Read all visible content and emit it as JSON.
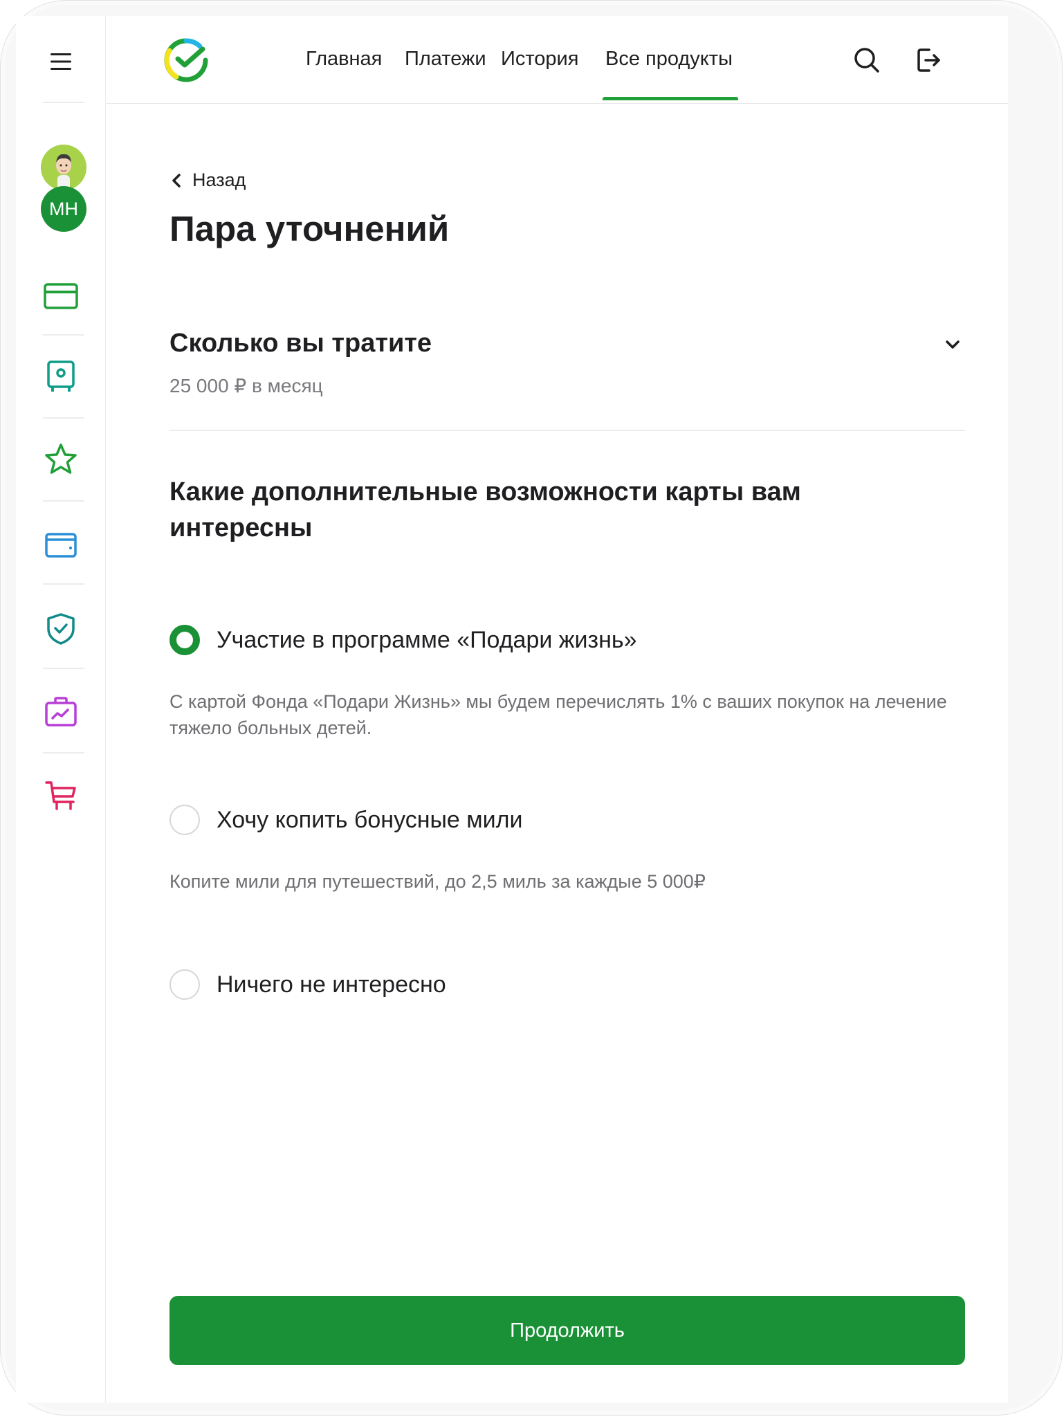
{
  "colors": {
    "brand_green": "#21a038",
    "button_green": "#1a9136",
    "avatar_green": "#1a9136",
    "text_primary": "#1f1f22",
    "text_secondary": "#6f6f73"
  },
  "nav": {
    "tabs": [
      {
        "label": "Главная"
      },
      {
        "label": "Платежи"
      },
      {
        "label": "История"
      },
      {
        "label": "Все продукты",
        "active": true
      }
    ]
  },
  "sidebar": {
    "avatar_initials": "МН",
    "items": [
      {
        "icon": "card-icon",
        "color": "#21a038"
      },
      {
        "icon": "safe-icon",
        "color": "#0f9d8a"
      },
      {
        "icon": "star-icon",
        "color": "#21a038"
      },
      {
        "icon": "wallet-icon",
        "color": "#2a8fd6"
      },
      {
        "icon": "shield-icon",
        "color": "#138a8a"
      },
      {
        "icon": "briefcase-chart-icon",
        "color": "#b83fd6"
      },
      {
        "icon": "cart-icon",
        "color": "#e0245e"
      }
    ]
  },
  "page": {
    "back_label": "Назад",
    "title": "Пара уточнений"
  },
  "spending": {
    "title": "Сколько вы тратите",
    "value": "25 000 ₽ в месяц"
  },
  "features": {
    "title": "Какие дополнительные возможности карты вам интересны",
    "options": [
      {
        "label": "Участие в программе «Подари жизнь»",
        "description": "С картой Фонда «Подари Жизнь» мы будем перечислять 1% с ваших покупок на лечение тяжело больных детей.",
        "selected": true
      },
      {
        "label": "Хочу копить бонусные мили",
        "description": "Копите мили для путешествий, до 2,5 миль за каждые 5 000₽",
        "selected": false
      },
      {
        "label": "Ничего не интересно",
        "description": "",
        "selected": false
      }
    ]
  },
  "cta": {
    "label": "Продолжить"
  }
}
